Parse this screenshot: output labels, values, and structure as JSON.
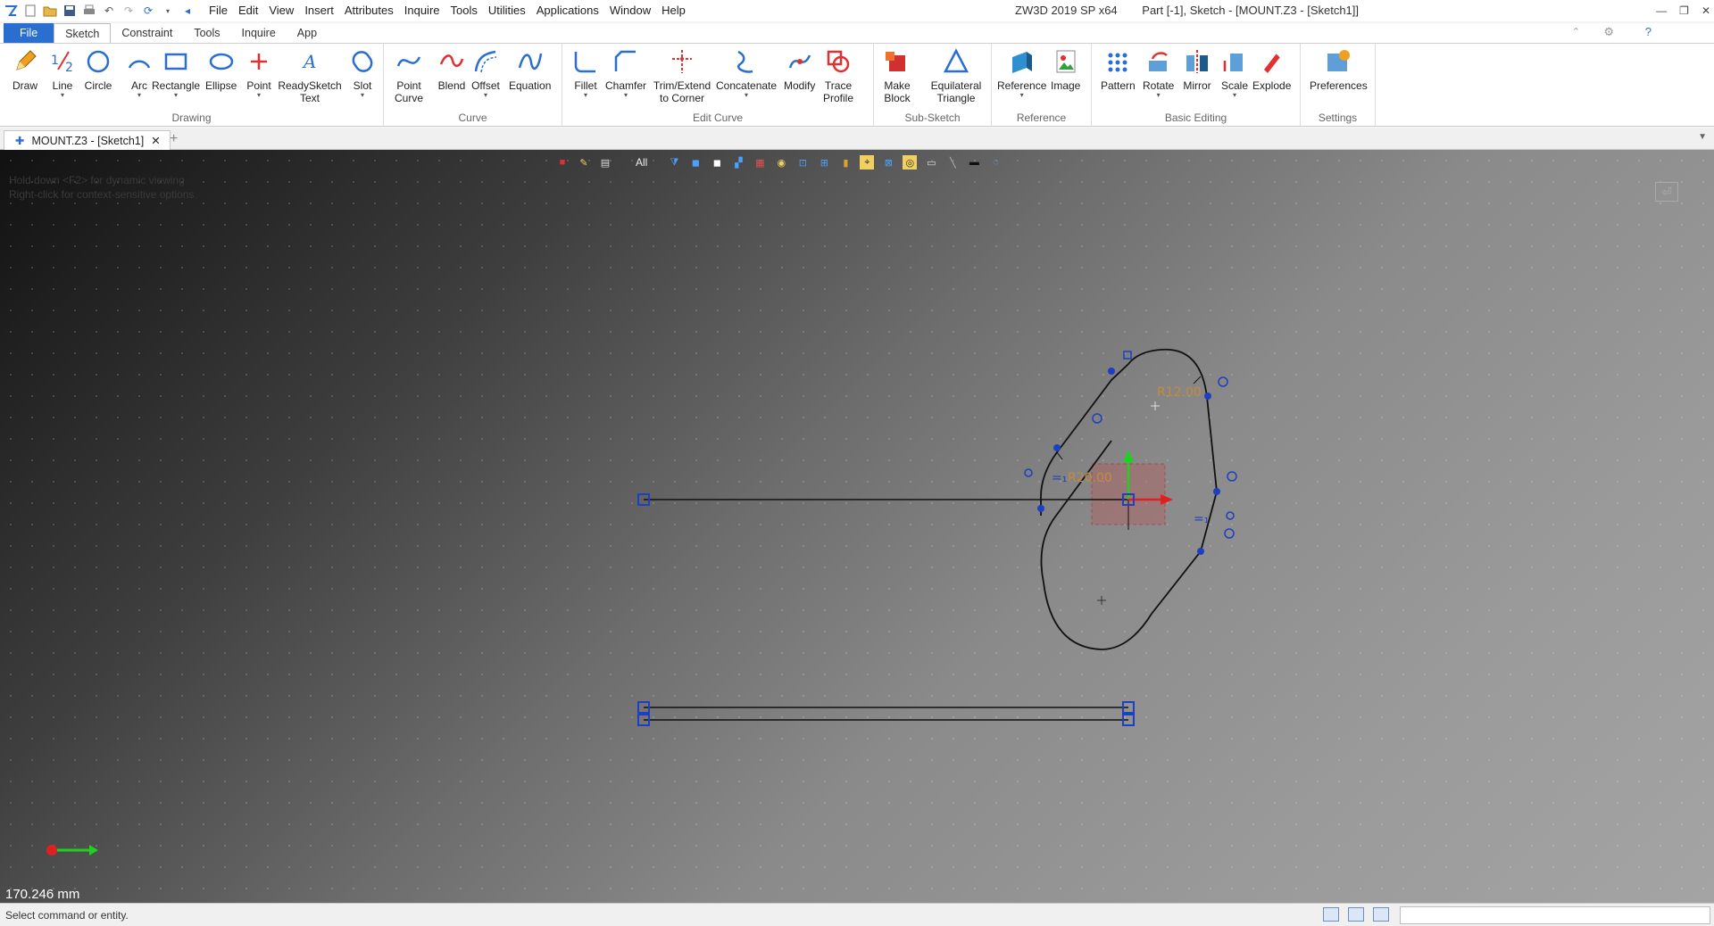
{
  "app": {
    "title_left": "ZW3D 2019 SP x64",
    "title_right": "Part [-1],  Sketch - [MOUNT.Z3 - [Sketch1]]"
  },
  "menu": [
    "File",
    "Edit",
    "View",
    "Insert",
    "Attributes",
    "Inquire",
    "Tools",
    "Utilities",
    "Applications",
    "Window",
    "Help"
  ],
  "ribbon_tabs": [
    "File",
    "Sketch",
    "Constraint",
    "Tools",
    "Inquire",
    "App"
  ],
  "groups": {
    "drawing": {
      "label": "Drawing",
      "tools": [
        "Draw",
        "Line",
        "Circle",
        "Arc",
        "Rectangle",
        "Ellipse",
        "Point",
        "ReadySketch\nText",
        "Slot"
      ]
    },
    "curve": {
      "label": "Curve",
      "tools": [
        "Point\nCurve",
        "Blend",
        "Offset",
        "Equation"
      ]
    },
    "edit_curve": {
      "label": "Edit Curve",
      "tools": [
        "Fillet",
        "Chamfer",
        "Trim/Extend\nto Corner",
        "Concatenate",
        "Modify",
        "Trace\nProfile"
      ]
    },
    "sub_sketch": {
      "label": "Sub-Sketch",
      "tools": [
        "Make\nBlock",
        "Equilateral\nTriangle"
      ]
    },
    "reference": {
      "label": "Reference",
      "tools": [
        "Reference",
        "Image"
      ]
    },
    "basic_editing": {
      "label": "Basic Editing",
      "tools": [
        "Pattern",
        "Rotate",
        "Mirror",
        "Scale",
        "Explode"
      ]
    },
    "settings": {
      "label": "Settings",
      "tools": [
        "Preferences"
      ]
    }
  },
  "doc_tab": {
    "label": "MOUNT.Z3 - [Sketch1]"
  },
  "viewport": {
    "hint_line1": "Hold down <F2> for dynamic viewing",
    "hint_line2": "Right-click for context-sensitive options",
    "filter_label": "All",
    "dimension_r12": "R12.00",
    "dimension_r20": "R20.00",
    "distance_readout": "170.246 mm"
  },
  "status": {
    "text": "Select command or entity."
  },
  "colors": {
    "file_tab": "#2a6ed0",
    "sketch_line": "#111111",
    "constraint_blue": "#1e3fbf",
    "dimension_orange": "#c88a3a",
    "axis_red": "#e02020",
    "axis_green": "#20d020"
  }
}
